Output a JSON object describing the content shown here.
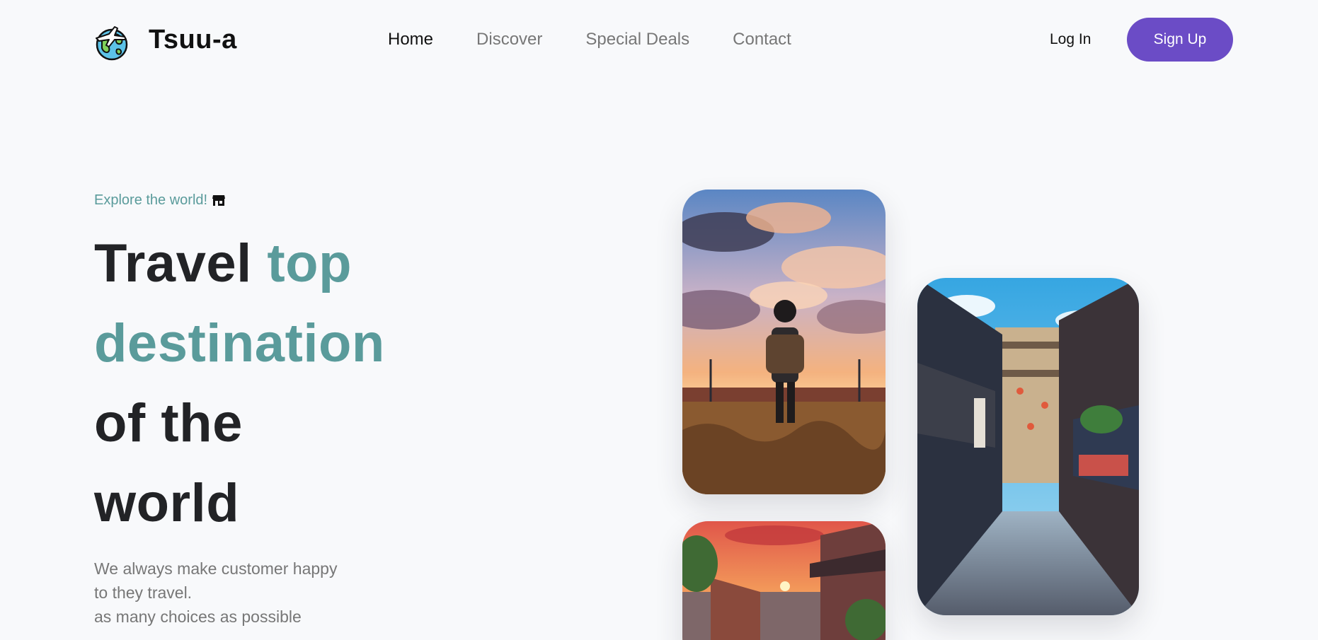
{
  "brand": {
    "name": "Tsuu-a",
    "logo_icon": "globe-plane-icon"
  },
  "nav": {
    "items": [
      {
        "label": "Home",
        "active": true
      },
      {
        "label": "Discover",
        "active": false
      },
      {
        "label": "Special Deals",
        "active": false
      },
      {
        "label": "Contact",
        "active": false
      }
    ]
  },
  "auth": {
    "login_label": "Log In",
    "signup_label": "Sign Up"
  },
  "hero": {
    "eyebrow": "Explore the world!",
    "eyebrow_icon": "shop-icon",
    "headline": {
      "part1": "Travel ",
      "part2": "top",
      "line2": "destination",
      "line3": "of the",
      "line4": "world"
    },
    "subtext": {
      "line1": "We always make customer happy",
      "line2": "to they travel.",
      "line3": "as many choices as possible"
    }
  },
  "gallery": {
    "images": [
      {
        "subject": "anime traveler with backpack at sunset by railway"
      },
      {
        "subject": "anime japanese alley street with hanging lanterns"
      },
      {
        "subject": "anime sunset over town rooftops"
      }
    ]
  },
  "colors": {
    "accent": "#5a9b9b",
    "brand": "#6b4cc6",
    "background": "#f8f9fb",
    "text": "#222326",
    "muted": "#777777"
  }
}
